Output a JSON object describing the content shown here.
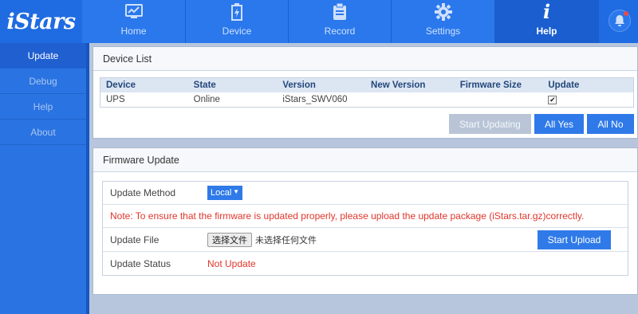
{
  "app": {
    "logo": "iStars"
  },
  "nav": [
    {
      "label": "Home",
      "icon": "chart-monitor-icon"
    },
    {
      "label": "Device",
      "icon": "battery-icon"
    },
    {
      "label": "Record",
      "icon": "clipboard-icon"
    },
    {
      "label": "Settings",
      "icon": "gear-icon"
    },
    {
      "label": "Help",
      "icon": "info-icon",
      "active": true
    }
  ],
  "sidebar": {
    "items": [
      {
        "label": "Update",
        "active": true
      },
      {
        "label": "Debug"
      },
      {
        "label": "Help"
      },
      {
        "label": "About"
      }
    ]
  },
  "device_list": {
    "title": "Device List",
    "columns": [
      "Device",
      "State",
      "Version",
      "New Version",
      "Firmware Size",
      "Update"
    ],
    "rows": [
      {
        "device": "UPS",
        "state": "Online",
        "version": "iStars_SWV060",
        "new_version": "",
        "firmware_size": "",
        "update_checked": true
      }
    ],
    "buttons": {
      "start_updating": "Start Updating",
      "all_yes": "All Yes",
      "all_no": "All No"
    }
  },
  "firmware_update": {
    "title": "Firmware Update",
    "method_label": "Update Method",
    "method_value": "Local",
    "note": "Note: To ensure that the firmware is updated properly, please upload the update package (iStars.tar.gz)correctly.",
    "file_label": "Update File",
    "choose_file": "选择文件",
    "no_file": "未选择任何文件",
    "start_upload": "Start Upload",
    "status_label": "Update Status",
    "status_value": "Not Update"
  },
  "colors": {
    "accent": "#1f6be2",
    "note_red": "#e0362c",
    "sidebar": "#2a73e2"
  }
}
